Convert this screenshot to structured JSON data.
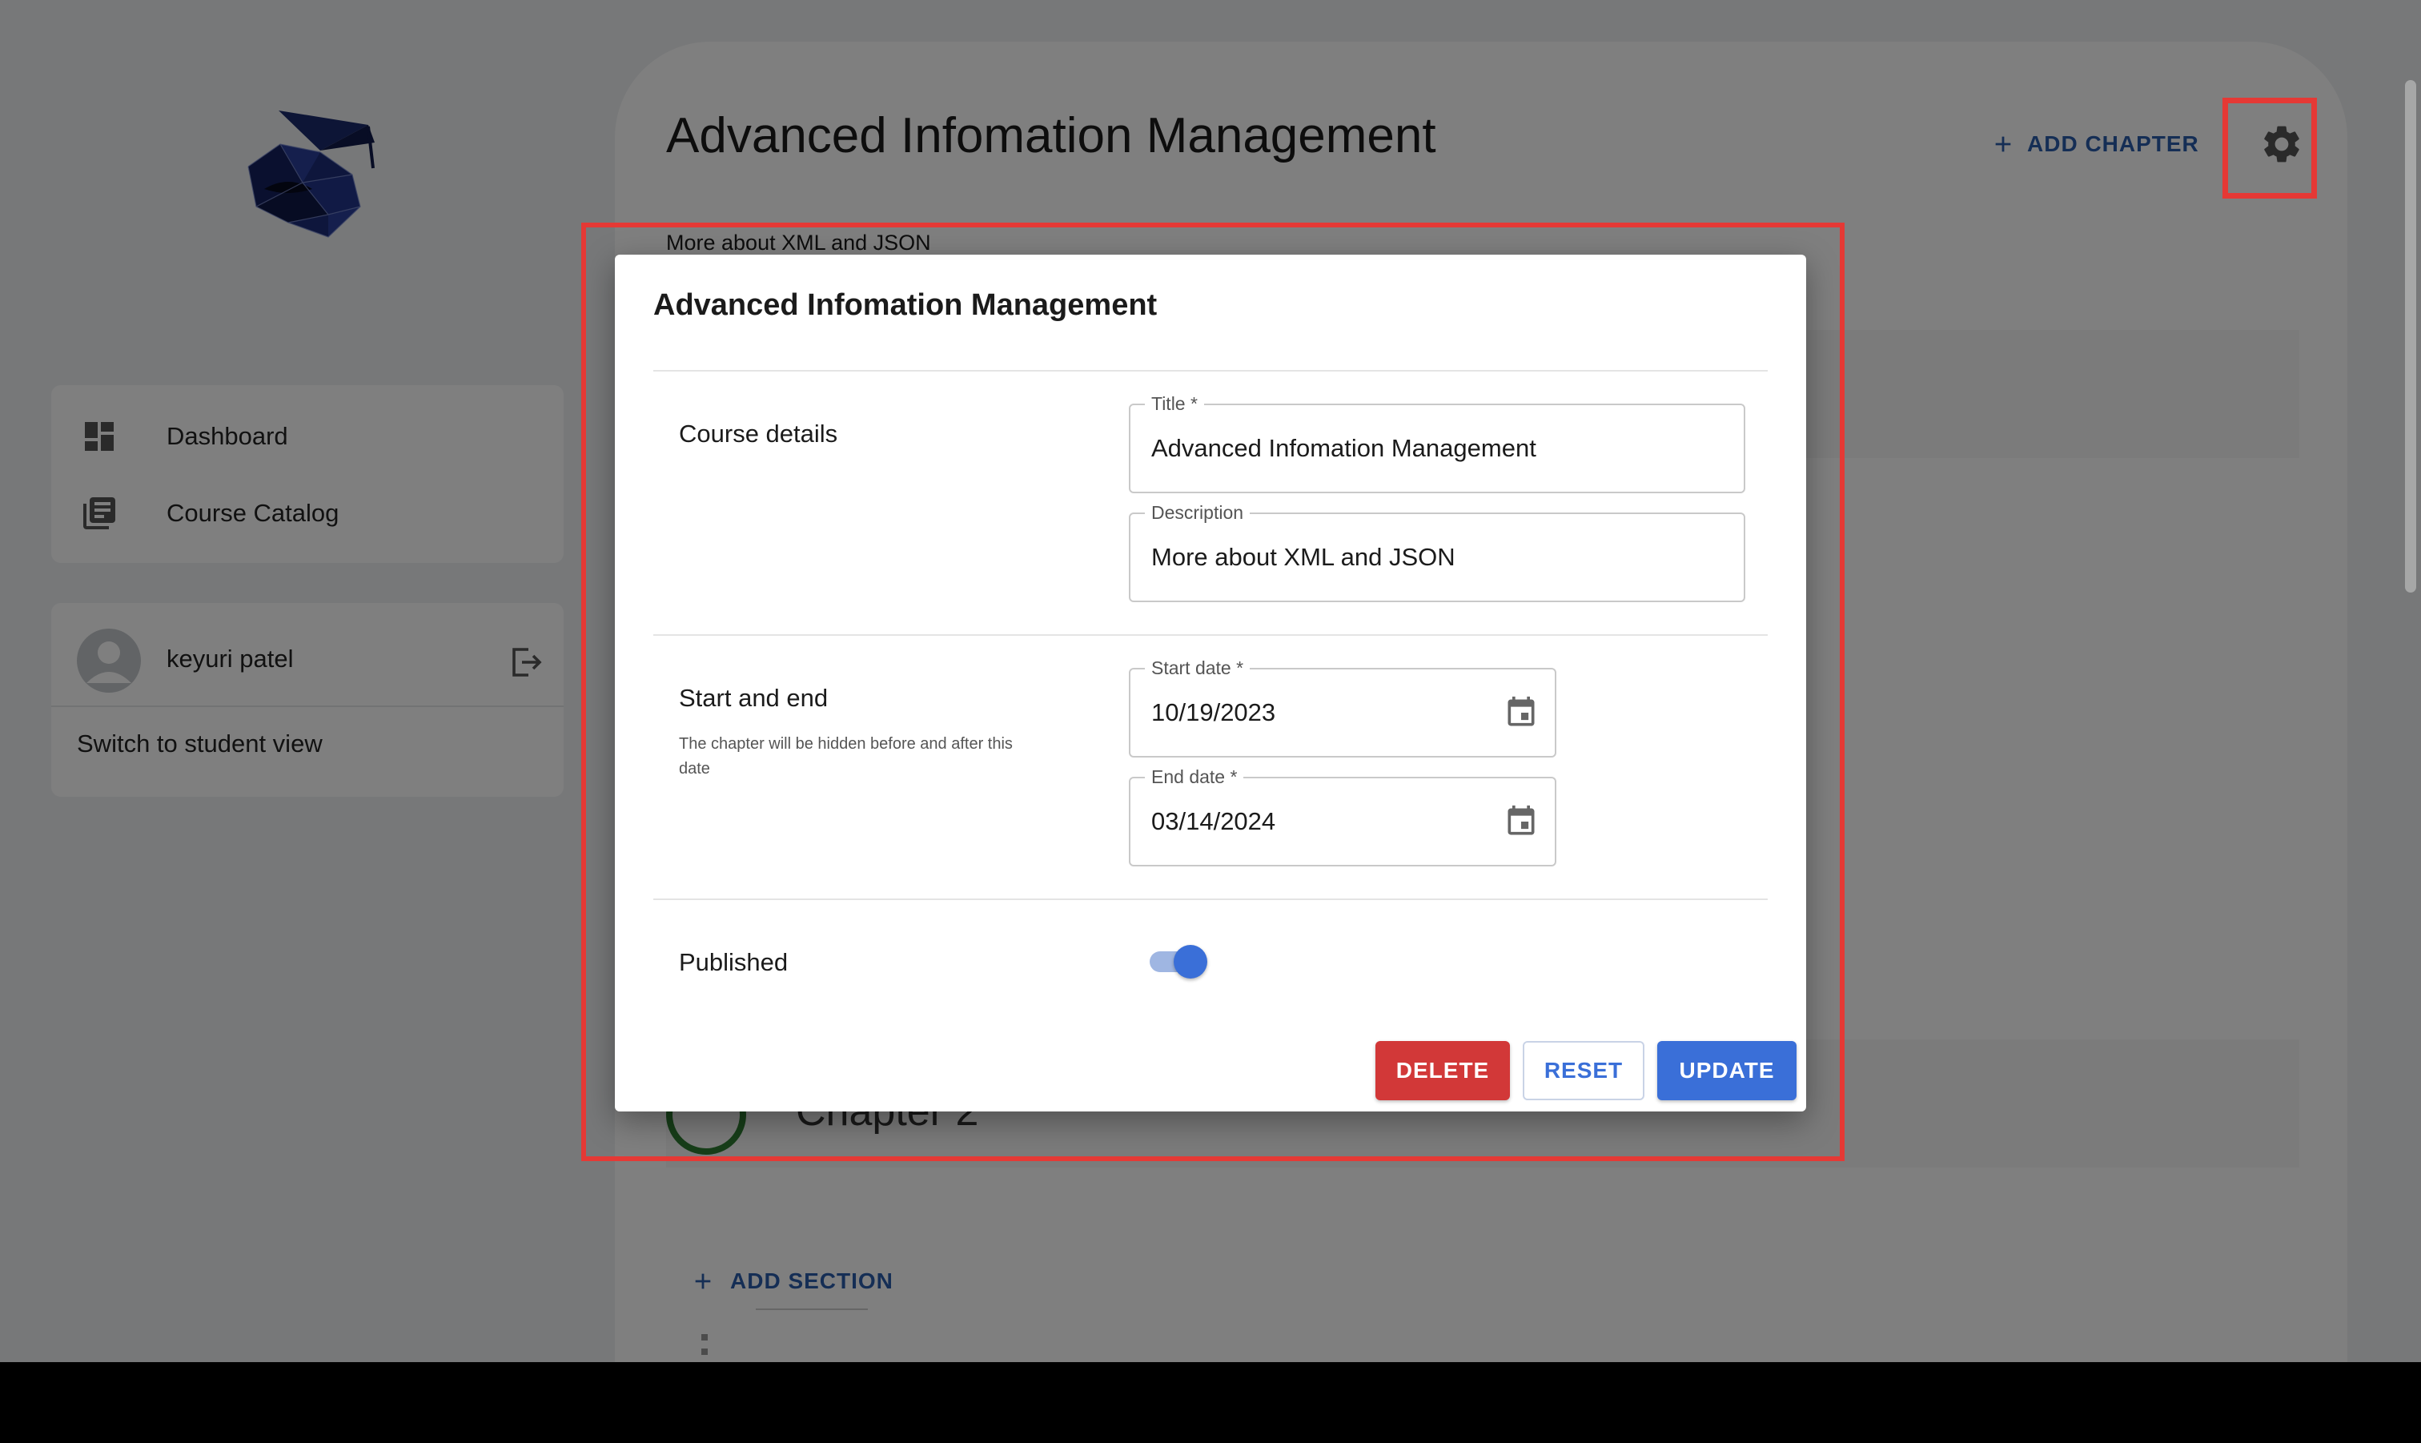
{
  "sidebar": {
    "nav": [
      {
        "label": "Dashboard",
        "icon": "dashboard-icon"
      },
      {
        "label": "Course Catalog",
        "icon": "library-books-icon"
      }
    ],
    "user": {
      "name": "keyuri patel",
      "switch_view_label": "Switch to student view"
    }
  },
  "course": {
    "title": "Advanced Infomation Management",
    "description": "More about XML and JSON",
    "add_chapter_label": "ADD CHAPTER",
    "chapter_label": "Chapter 2",
    "add_section_label": "ADD SECTION"
  },
  "dialog": {
    "title": "Advanced Infomation Management",
    "sections": {
      "details_label": "Course details",
      "dates_label": "Start and end",
      "dates_help": "The chapter will be hidden before and after this date",
      "published_label": "Published"
    },
    "fields": {
      "title": {
        "label": "Title *",
        "value": "Advanced Infomation Management"
      },
      "description": {
        "label": "Description",
        "value": "More about XML and JSON"
      },
      "start_date": {
        "label": "Start date *",
        "value": "10/19/2023"
      },
      "end_date": {
        "label": "End date *",
        "value": "03/14/2024"
      }
    },
    "published": true,
    "buttons": {
      "delete": "DELETE",
      "reset": "RESET",
      "update": "UPDATE"
    }
  },
  "colors": {
    "primary": "#3a6fd8",
    "danger": "#d23838",
    "highlight": "#e53935",
    "success": "#2e7d32"
  }
}
